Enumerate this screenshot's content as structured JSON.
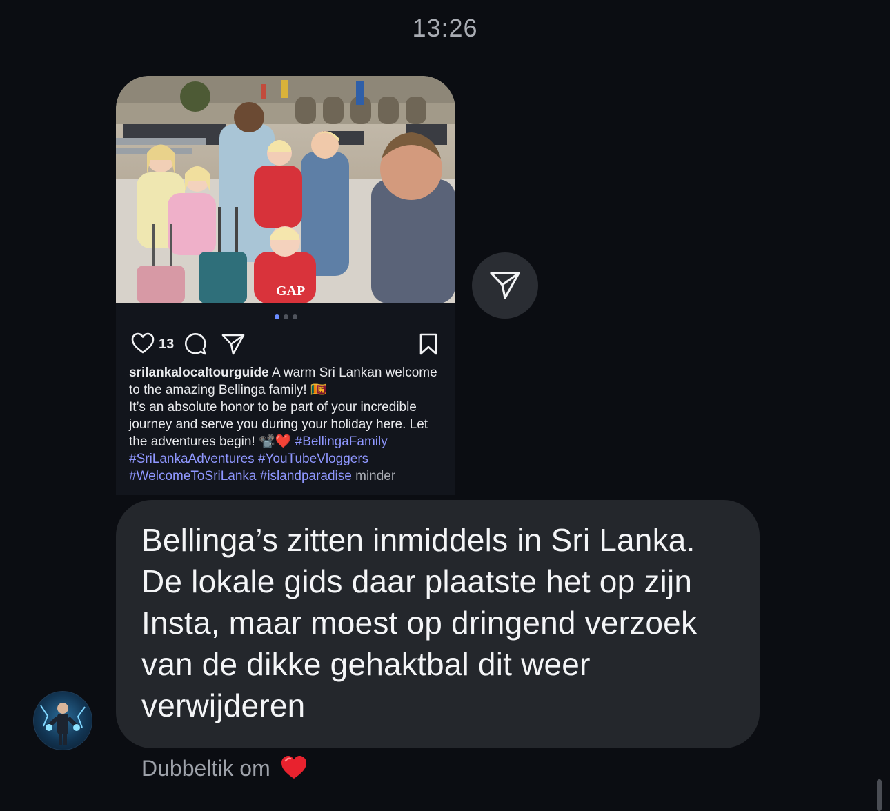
{
  "timestamp": "13:26",
  "post": {
    "likes": "13",
    "username": "srilankalocaltourguide",
    "caption_line1": " A warm Sri Lankan welcome to the amazing Bellinga family! 🇱🇰",
    "caption_line2": "It’s an absolute honor to be part of your incredible journey and serve you during your holiday here. Let the adventures begin! 📽️❤️ ",
    "hashtags": [
      "#BellingaFamily",
      "#SriLankaAdventures",
      "#YouTubeVloggers",
      "#WelcomeToSriLanka",
      "#islandparadise"
    ],
    "less_label": "minder",
    "shirt_text": "GAP",
    "carousel": {
      "count": 3,
      "active": 0
    }
  },
  "message": {
    "text": "Bellinga’s zitten inmiddels in Sri Lanka. De lokale gids daar plaatste het op zijn Insta, maar moest op dringend verzoek van de dikke gehaktbal dit weer verwijderen"
  },
  "hint": {
    "label": "Dubbeltik om",
    "emoji": "heart"
  },
  "colors": {
    "background": "#0b0d12",
    "bubble": "#24272c",
    "hashtag": "#8f97ff",
    "carousel_active": "#6b8cff"
  },
  "icons": [
    "heart-icon",
    "comment-icon",
    "share-icon",
    "bookmark-icon",
    "send-icon",
    "red-heart-icon"
  ]
}
